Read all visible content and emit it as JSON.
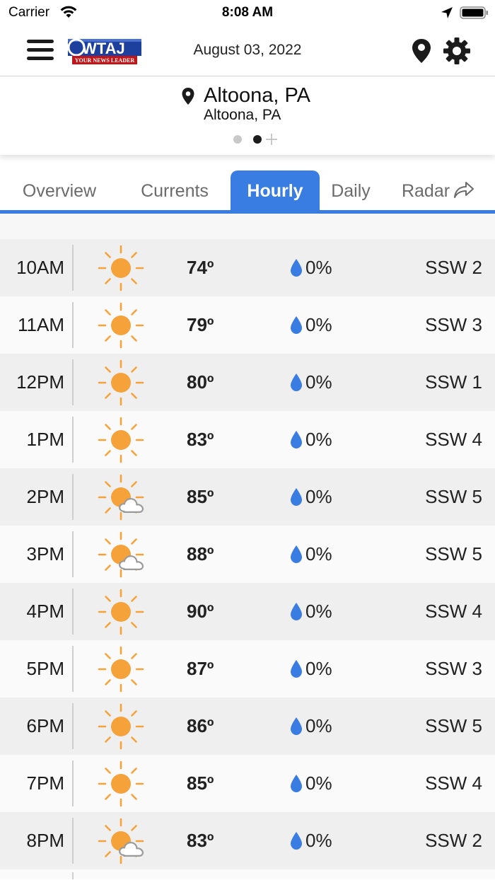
{
  "status_bar": {
    "carrier": "Carrier",
    "time": "8:08 AM"
  },
  "header": {
    "logo_text": "WTAJ",
    "logo_tagline": "YOUR NEWS LEADER",
    "date": "August 03, 2022"
  },
  "location": {
    "city": "Altoona, PA",
    "subtitle": "Altoona, PA",
    "page_count": 2,
    "active_page": 2
  },
  "tabs": [
    {
      "label": "Overview",
      "active": false
    },
    {
      "label": "Currents",
      "active": false
    },
    {
      "label": "Hourly",
      "active": true
    },
    {
      "label": "Daily",
      "active": false
    },
    {
      "label": "Radar",
      "active": false
    }
  ],
  "colors": {
    "accent": "#3a7de2",
    "sun": "#f6a23a",
    "drop": "#3a7de2"
  },
  "hourly": [
    {
      "time": "10AM",
      "icon": "sunny-icon",
      "temp": "74º",
      "precip": "0%",
      "wind": "SSW 2"
    },
    {
      "time": "11AM",
      "icon": "sunny-icon",
      "temp": "79º",
      "precip": "0%",
      "wind": "SSW 3"
    },
    {
      "time": "12PM",
      "icon": "sunny-icon",
      "temp": "80º",
      "precip": "0%",
      "wind": "SSW 1"
    },
    {
      "time": "1PM",
      "icon": "sunny-icon",
      "temp": "83º",
      "precip": "0%",
      "wind": "SSW 4"
    },
    {
      "time": "2PM",
      "icon": "partly-cloudy-icon",
      "temp": "85º",
      "precip": "0%",
      "wind": "SSW 5"
    },
    {
      "time": "3PM",
      "icon": "partly-cloudy-icon",
      "temp": "88º",
      "precip": "0%",
      "wind": "SSW 5"
    },
    {
      "time": "4PM",
      "icon": "sunny-icon",
      "temp": "90º",
      "precip": "0%",
      "wind": "SSW 4"
    },
    {
      "time": "5PM",
      "icon": "sunny-icon",
      "temp": "87º",
      "precip": "0%",
      "wind": "SSW 3"
    },
    {
      "time": "6PM",
      "icon": "sunny-icon",
      "temp": "86º",
      "precip": "0%",
      "wind": "SSW 5"
    },
    {
      "time": "7PM",
      "icon": "sunny-icon",
      "temp": "85º",
      "precip": "0%",
      "wind": "SSW 4"
    },
    {
      "time": "8PM",
      "icon": "partly-cloudy-icon",
      "temp": "83º",
      "precip": "0%",
      "wind": "SSW 2"
    }
  ]
}
